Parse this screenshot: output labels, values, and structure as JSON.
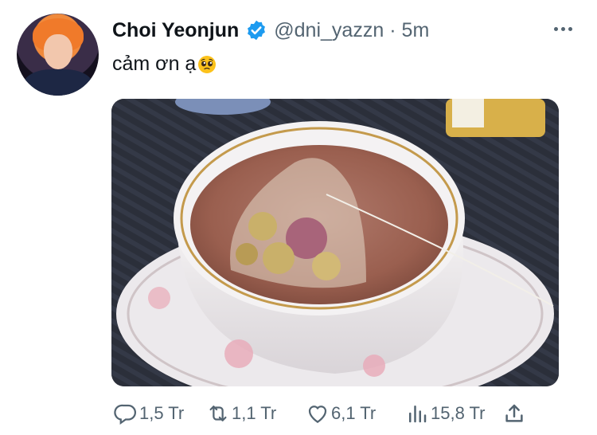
{
  "tweet": {
    "author": {
      "name": "Choi Yeonjun",
      "handle": "@dni_yazzn",
      "separator": "·",
      "time": "5m"
    },
    "text": "cảm ơn ạ",
    "emoji": "pleading-face-emoji",
    "media": {
      "description_icon": "photo"
    },
    "actions": {
      "replies": "1,5 Tr",
      "retweets": "1,1 Tr",
      "likes": "6,1 Tr",
      "views": "15,8 Tr"
    }
  },
  "colors": {
    "text_primary": "#0f1419",
    "text_secondary": "#536471",
    "verified": "#1d9bf0"
  }
}
